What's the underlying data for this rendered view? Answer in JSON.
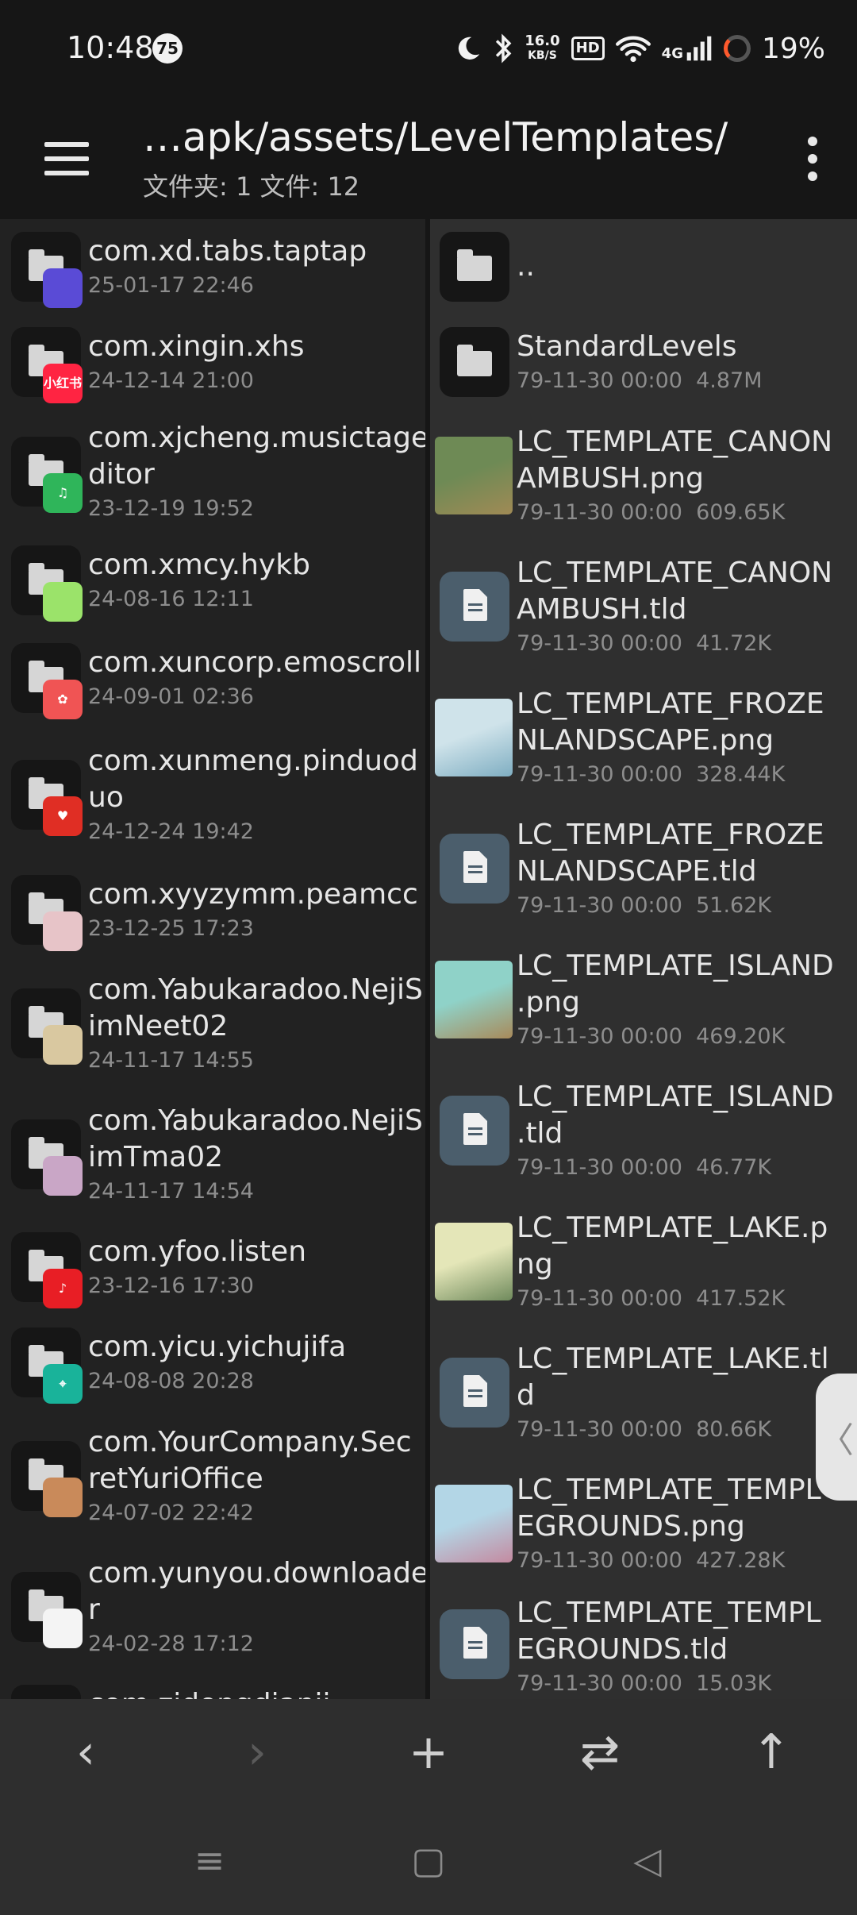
{
  "status_bar": {
    "time": "10:48",
    "notification_count": "75",
    "net_speed_top": "16.0",
    "net_speed_bottom": "KB/S",
    "hd_label": "HD",
    "network_label": "4G",
    "battery": "19%",
    "battery_level": 0.19,
    "battery_ring_color": "#ff5a2d"
  },
  "app_bar": {
    "path": "…apk/assets/LevelTemplates/",
    "summary": "文件夹: 1  文件: 12"
  },
  "left_pane": {
    "items": [
      {
        "name": "com.xd.tabs.taptap",
        "meta": "25-01-17 22:46",
        "badge_text": "",
        "badge_color": "#5a4bd6"
      },
      {
        "name": "com.xingin.xhs",
        "meta": "24-12-14 21:00",
        "badge_text": "小红书",
        "badge_color": "#ff2442"
      },
      {
        "name": "com.xjcheng.musictage\nditor",
        "meta": "23-12-19 19:52",
        "badge_text": "♫",
        "badge_color": "#2fb55a"
      },
      {
        "name": "com.xmcy.hykb",
        "meta": "24-08-16 12:11",
        "badge_text": "",
        "badge_color": "#9be36a"
      },
      {
        "name": "com.xuncorp.emoscroll",
        "meta": "24-09-01 02:36",
        "badge_text": "✿",
        "badge_color": "#f05454"
      },
      {
        "name": "com.xunmeng.pinduod\nuo",
        "meta": "24-12-24 19:42",
        "badge_text": "♥",
        "badge_color": "#e02e24"
      },
      {
        "name": "com.xyyzymm.peamcc",
        "meta": "23-12-25 17:23",
        "badge_text": "",
        "badge_color": "#e7c4c8"
      },
      {
        "name": "com.Yabukaradoo.NejiS\nimNeet02",
        "meta": "24-11-17 14:55",
        "badge_text": "",
        "badge_color": "#d9c8a0"
      },
      {
        "name": "com.Yabukaradoo.NejiS\nimTma02",
        "meta": "24-11-17 14:54",
        "badge_text": "",
        "badge_color": "#c9a6c6"
      },
      {
        "name": "com.yfoo.listen",
        "meta": "23-12-16 17:30",
        "badge_text": "♪",
        "badge_color": "#e81e25"
      },
      {
        "name": "com.yicu.yichujifa",
        "meta": "24-08-08 20:28",
        "badge_text": "⌖",
        "badge_color": "#19b39a"
      },
      {
        "name": "com.YourCompany.Sec\nretYuriOffice",
        "meta": "24-07-02 22:42",
        "badge_text": "",
        "badge_color": "#c98a5a"
      },
      {
        "name": "com.yunyou.downloade\nr",
        "meta": "24-02-28 17:12",
        "badge_text": "",
        "badge_color": "#f4f4f4"
      },
      {
        "name": "com.zidongdianji",
        "meta": "",
        "badge_text": "",
        "badge_color": "#222222"
      }
    ]
  },
  "right_pane": {
    "items": [
      {
        "kind": "folder",
        "name": "..",
        "meta": ""
      },
      {
        "kind": "folder",
        "name": "StandardLevels",
        "meta": "79-11-30 00:00  4.87M"
      },
      {
        "kind": "image",
        "name": "LC_TEMPLATE_CANON\nAMBUSH.png",
        "meta": "79-11-30 00:00  609.65K",
        "thumb_colors": [
          "#6e8a55",
          "#a08a55"
        ]
      },
      {
        "kind": "file",
        "name": "LC_TEMPLATE_CANON\nAMBUSH.tld",
        "meta": "79-11-30 00:00  41.72K"
      },
      {
        "kind": "image",
        "name": "LC_TEMPLATE_FROZE\nNLANDSCAPE.png",
        "meta": "79-11-30 00:00  328.44K",
        "thumb_colors": [
          "#cfe3ea",
          "#7faec2"
        ]
      },
      {
        "kind": "file",
        "name": "LC_TEMPLATE_FROZE\nNLANDSCAPE.tld",
        "meta": "79-11-30 00:00  51.62K"
      },
      {
        "kind": "image",
        "name": "LC_TEMPLATE_ISLAND\n.png",
        "meta": "79-11-30 00:00  469.20K",
        "thumb_colors": [
          "#8fd2c8",
          "#a88a5a"
        ]
      },
      {
        "kind": "file",
        "name": "LC_TEMPLATE_ISLAND\n.tld",
        "meta": "79-11-30 00:00  46.77K"
      },
      {
        "kind": "image",
        "name": "LC_TEMPLATE_LAKE.p\nng",
        "meta": "79-11-30 00:00  417.52K",
        "thumb_colors": [
          "#e4e6b8",
          "#6f8a5c"
        ]
      },
      {
        "kind": "file",
        "name": "LC_TEMPLATE_LAKE.tl\nd",
        "meta": "79-11-30 00:00  80.66K"
      },
      {
        "kind": "image",
        "name": "LC_TEMPLATE_TEMPL\nEGROUNDS.png",
        "meta": "79-11-30 00:00  427.28K",
        "thumb_colors": [
          "#b3d6e6",
          "#c48aa0"
        ]
      },
      {
        "kind": "file",
        "name": "LC_TEMPLATE_TEMPL\nEGROUNDS.tld",
        "meta": "79-11-30 00:00  15.03K"
      }
    ]
  },
  "toolbar": {
    "back": "‹",
    "forward": "›",
    "add": "+",
    "swap": "⇄",
    "up": "↑"
  },
  "navbar": {
    "recents": "≡",
    "home": "▢",
    "back": "◁"
  },
  "edge_handle": "〈"
}
